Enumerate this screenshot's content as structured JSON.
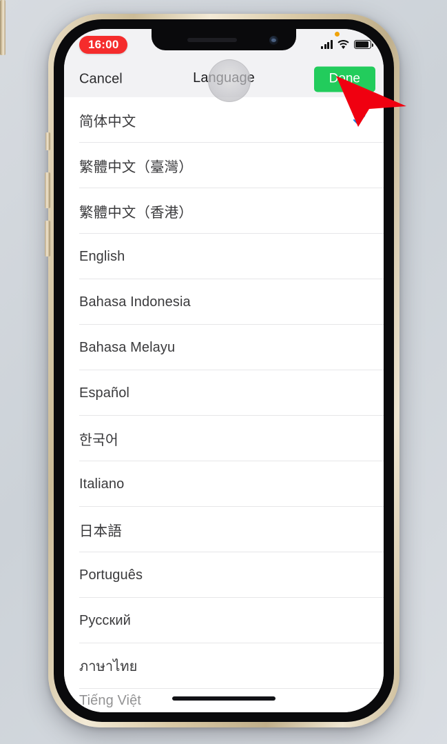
{
  "device": {
    "name": "iPhone",
    "frame_color": "#d9c9a6",
    "bezel_color": "#0a0a0c"
  },
  "status_bar": {
    "time": "16:00",
    "time_pill_color": "#f52c2c",
    "mic_indicator": "orange-dot",
    "icons": [
      "cellular-signal-icon",
      "wifi-icon",
      "battery-icon"
    ]
  },
  "nav_bar": {
    "cancel_label": "Cancel",
    "title": "Language",
    "done_label": "Done",
    "done_color": "#22cc5c",
    "background": "#f2f2f4"
  },
  "language_list": {
    "selected": "简体中文",
    "checkmark_color": "#1782e6",
    "items": [
      {
        "label": "简体中文",
        "selected": true
      },
      {
        "label": "繁體中文（臺灣）",
        "selected": false
      },
      {
        "label": "繁體中文（香港）",
        "selected": false
      },
      {
        "label": "English",
        "selected": false
      },
      {
        "label": "Bahasa Indonesia",
        "selected": false
      },
      {
        "label": "Bahasa Melayu",
        "selected": false
      },
      {
        "label": "Español",
        "selected": false
      },
      {
        "label": "한국어",
        "selected": false
      },
      {
        "label": "Italiano",
        "selected": false
      },
      {
        "label": "日本語",
        "selected": false
      },
      {
        "label": "Português",
        "selected": false
      },
      {
        "label": "Русский",
        "selected": false
      },
      {
        "label": "ภาษาไทย",
        "selected": false
      },
      {
        "label": "Tiếng Việt",
        "selected": false,
        "partial": true
      }
    ]
  },
  "overlays": {
    "touch_indicator": "tap-circle",
    "cursor": "red-arrow-pointer",
    "cursor_color": "#f00010"
  }
}
